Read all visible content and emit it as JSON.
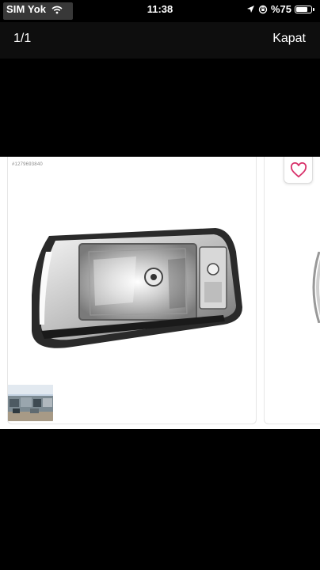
{
  "status_bar": {
    "carrier": "SIM Yok",
    "time": "11:38",
    "battery_text": "%75",
    "battery_level": 0.75,
    "icons": [
      "wifi-icon",
      "location-arrow-icon",
      "orientation-lock-icon",
      "battery-icon"
    ]
  },
  "header": {
    "counter": "1/1",
    "close_label": "Kapat"
  },
  "gallery": {
    "listing_number": "#1279693840",
    "main_image": "car-headlight-photo",
    "thumbnail_image": "car-lot-photo",
    "favorite_icon": "heart-icon",
    "accent_color": "#d8326b"
  }
}
